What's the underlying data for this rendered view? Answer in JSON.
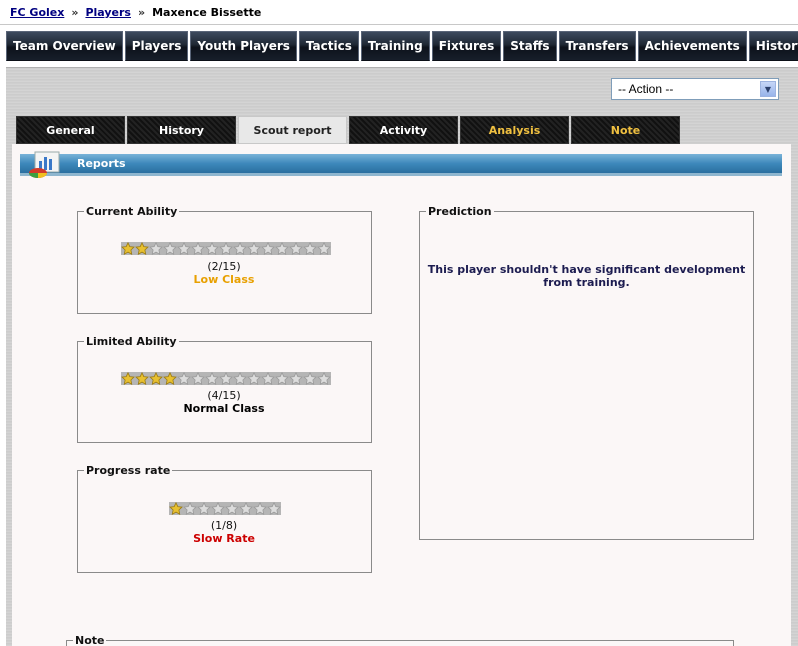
{
  "breadcrumb": {
    "club": "FC Golex",
    "players": "Players",
    "player": "Maxence Bissette",
    "sep": "»"
  },
  "mainnav": [
    "Team Overview",
    "Players",
    "Youth Players",
    "Tactics",
    "Training",
    "Fixtures",
    "Staffs",
    "Transfers",
    "Achievements",
    "History"
  ],
  "action_select": {
    "value": "-- Action --"
  },
  "tabs": [
    {
      "label": "General",
      "active": false,
      "gold": false
    },
    {
      "label": "History",
      "active": false,
      "gold": false
    },
    {
      "label": "Scout report",
      "active": true,
      "gold": false
    },
    {
      "label": "Activity",
      "active": false,
      "gold": false
    },
    {
      "label": "Analysis",
      "active": false,
      "gold": true
    },
    {
      "label": "Note",
      "active": false,
      "gold": true
    }
  ],
  "section": {
    "title": "Reports"
  },
  "current_ability": {
    "legend": "Current Ability",
    "stars": 2,
    "max": 15,
    "score": "(2/15)",
    "class": "Low Class",
    "class_color": "#e8a000"
  },
  "limited_ability": {
    "legend": "Limited Ability",
    "stars": 4,
    "max": 15,
    "score": "(4/15)",
    "class": "Normal Class",
    "class_color": "#000000"
  },
  "progress_rate": {
    "legend": "Progress rate",
    "stars": 1,
    "max": 8,
    "score": "(1/8)",
    "class": "Slow Rate",
    "class_color": "#cc0000"
  },
  "prediction": {
    "legend": "Prediction",
    "text": "This player shouldn't have significant development from training."
  },
  "note": {
    "legend": "Note"
  }
}
